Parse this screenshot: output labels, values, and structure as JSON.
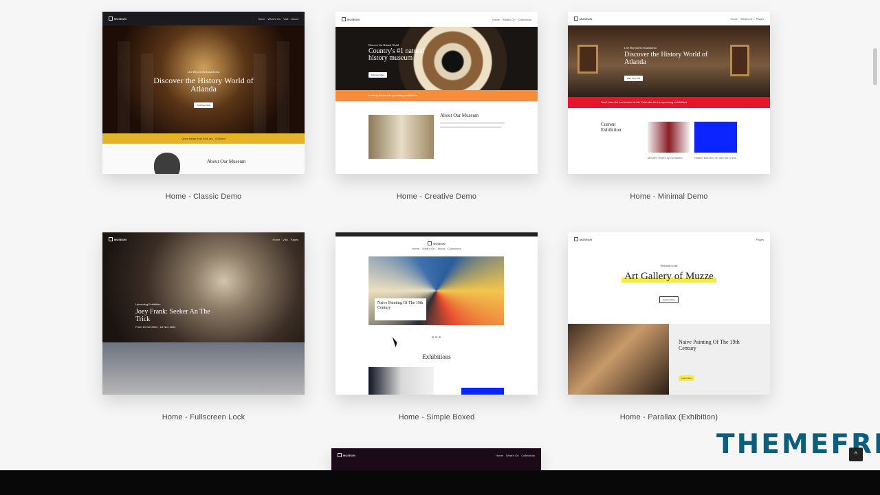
{
  "colors": {
    "page_bg": "#f6f6f6",
    "classic_yellow": "#e5b229",
    "creative_orange": "#f58d3a",
    "minimal_red": "#e6142c",
    "bottom_bar": "#080808",
    "watermark": "#0b5f7d"
  },
  "demos": [
    {
      "title": "Home - Classic Demo",
      "logo": "MUSEUM",
      "hero_kicker": "Live Beyond At Sonambrenu",
      "hero_title": "Discover the History World of Atlanda",
      "button": "Purchase Now",
      "bar_text": "Open today from 8:00 am - 5:30 pm",
      "section_title": "About Our Museum"
    },
    {
      "title": "Home - Creative Demo",
      "logo": "MUSEUM",
      "hero_kicker": "Discover the Natural World",
      "hero_title": "Country's #1 natural history museum",
      "button": "Discover More",
      "bar_text": "Looking forward to upcoming exhibitions",
      "section_title": "About Our Museum"
    },
    {
      "title": "Home - Minimal Demo",
      "logo": "MUSEUM",
      "hero_kicker": "Live Beyond At Sonambrenu",
      "hero_title": "Discover the History World of Atlanda",
      "button": "Plan Your Visit",
      "bar_text": "Don't miss the event soon at the Calendar for the upcoming exhibitions",
      "section_title": "Current Exhibition",
      "exhibit_1": "McIntyr: Works by Gerstaedt",
      "exhibit_2": "Hidden Descent VII with Ian Creek"
    },
    {
      "title": "Home - Fullscreen Lock",
      "logo": "MUSEUM",
      "hero_kicker": "Upcoming Exhibition",
      "hero_title": "Joey Frank: Seeker An The Trick",
      "hero_date": "From 10 Oct 2024 - 10 Nov 2024"
    },
    {
      "title": "Home - Simple Boxed",
      "logo": "MUSEUM",
      "caption_title": "Naive Painting Of The 19th Century",
      "section_title": "Exhibitions"
    },
    {
      "title": "Home - Parallax (Exhibition)",
      "logo": "MUSEUM",
      "welcome": "Welcome to the",
      "hero_title": "Art Gallery of Muzze",
      "button": "Explore More",
      "section_title": "Naive Painting Of The 19th Century",
      "cta": "Learn More"
    }
  ],
  "nav_items": [
    "Home",
    "What's On",
    "Visit",
    "About",
    "Collections",
    "Pages"
  ],
  "watermark": "THEMEFRE"
}
